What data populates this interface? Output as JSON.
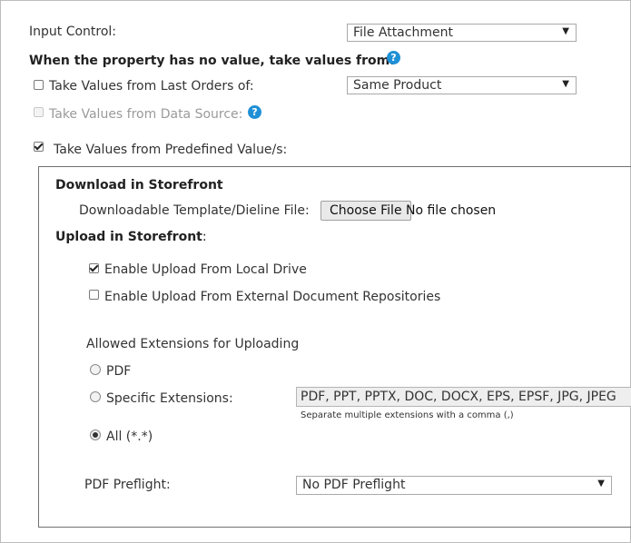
{
  "input_control": {
    "label": "Input Control:",
    "selected": "File Attachment"
  },
  "no_value_heading": "When the property has no value, take values from:",
  "help_glyph": "?",
  "last_orders": {
    "label": "Take Values from Last Orders of:",
    "checked": false,
    "selected": "Same Product"
  },
  "data_source": {
    "label": "Take Values from Data Source:",
    "checked": false,
    "disabled": true
  },
  "predefined": {
    "label": "Take Values from Predefined Value/s:",
    "checked": true
  },
  "download": {
    "heading": "Download in Storefront",
    "template_label": "Downloadable Template/Dieline File:",
    "choose_button": "Choose File",
    "file_status": "No file chosen"
  },
  "upload": {
    "heading": "Upload in Storefront",
    "heading_suffix": ":",
    "local_drive": {
      "label": "Enable Upload From Local Drive",
      "checked": true
    },
    "external_repos": {
      "label": "Enable Upload From External Document Repositories",
      "checked": false
    },
    "extensions_label": "Allowed Extensions for Uploading",
    "options": {
      "pdf": {
        "label": "PDF",
        "selected": false
      },
      "specific": {
        "label": "Specific Extensions:",
        "selected": false
      },
      "all": {
        "label": "All (*.*)",
        "selected": true
      }
    },
    "specific_value": "PDF, PPT, PPTX, DOC, DOCX, EPS, EPSF, JPG, JPEG",
    "specific_hint": "Separate multiple extensions with a comma (,)"
  },
  "preflight": {
    "label": "PDF Preflight:",
    "selected": "No PDF Preflight"
  },
  "icons": {
    "dropdown": "▼"
  }
}
